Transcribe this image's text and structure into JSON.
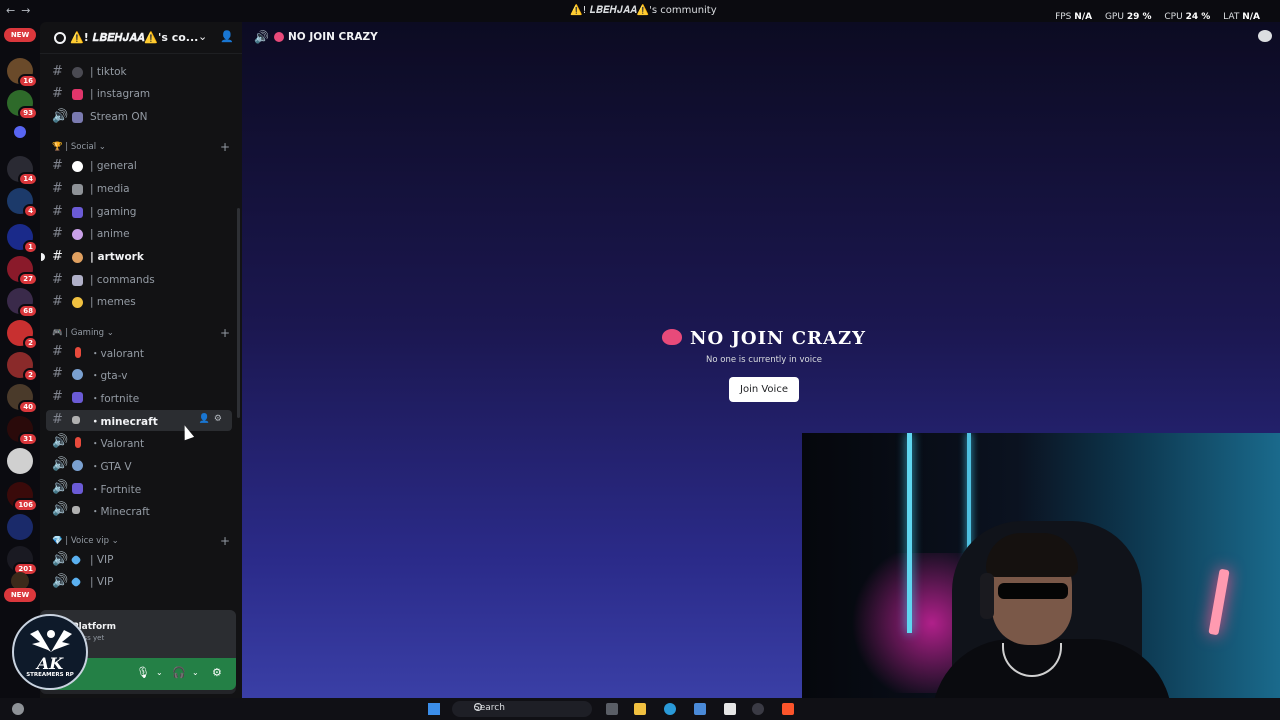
{
  "titlebar": {
    "server_title": "⚠️! 𝑳𝑩𝑬𝑯𝑱𝑨𝑨⚠️'s community",
    "fps_label": "FPS",
    "fps_value": "N/A",
    "gpu_label": "GPU",
    "gpu_value": "29 %",
    "cpu_label": "CPU",
    "cpu_value": "24 %",
    "lat_label": "LAT",
    "lat_value": "N/A"
  },
  "server_rail": {
    "new_top": "NEW",
    "new_bottom": "NEW",
    "badges": [
      "16",
      "93",
      "14",
      "4",
      "1",
      "27",
      "68",
      "2",
      "2",
      "40",
      "31",
      "106",
      "201"
    ]
  },
  "guild": {
    "name": "⚠️! 𝑳𝑩𝑬𝑯𝑱𝑨𝑨⚠️'s co..."
  },
  "channels": {
    "top": [
      {
        "type": "text",
        "label": "| tiktok",
        "color": "#4a4a52"
      },
      {
        "type": "text",
        "label": "| instagram",
        "color": "#e0356a"
      },
      {
        "type": "voice",
        "label": "Stream ON",
        "color": "#7a7ab0"
      }
    ],
    "social": {
      "name": "| Social",
      "items": [
        {
          "type": "text",
          "label": "| general",
          "color": "#ffffff"
        },
        {
          "type": "text",
          "label": "| media",
          "color": "#8e9297"
        },
        {
          "type": "text",
          "label": "| gaming",
          "color": "#6b5bd6"
        },
        {
          "type": "text",
          "label": "| anime",
          "color": "#c9a0e8"
        },
        {
          "type": "text",
          "label": "| artwork",
          "color": "#e0a060",
          "bold": true
        },
        {
          "type": "text",
          "label": "| commands",
          "color": "#b0b0c8"
        },
        {
          "type": "text",
          "label": "| memes",
          "color": "#f0c040"
        }
      ]
    },
    "gaming": {
      "name": "| Gaming",
      "items": [
        {
          "type": "text",
          "label": "・valorant",
          "color": "#e84a3c"
        },
        {
          "type": "text",
          "label": "・gta-v",
          "color": "#7aa0d0"
        },
        {
          "type": "text",
          "label": "・fortnite",
          "color": "#6b5bd6"
        },
        {
          "type": "text",
          "label": "・minecraft",
          "color": "#b0b0b0",
          "active": true
        },
        {
          "type": "voice",
          "label": "・Valorant",
          "color": "#e84a3c"
        },
        {
          "type": "voice",
          "label": "・GTA V",
          "color": "#7aa0d0"
        },
        {
          "type": "voice",
          "label": "・Fortnite",
          "color": "#6b5bd6"
        },
        {
          "type": "voice",
          "label": "・Minecraft",
          "color": "#b0b0b0"
        }
      ]
    },
    "voice_vip": {
      "name": "| Voice vip",
      "items": [
        {
          "type": "voice",
          "label": "| VIP",
          "color": "#5ab0f0"
        },
        {
          "type": "voice",
          "label": "| VIP",
          "color": "#5ab0f0"
        }
      ]
    }
  },
  "user_panel": {
    "activity_name": "Platform",
    "activity_sub": "gress yet",
    "logo_text": "AK",
    "logo_sub": "STREAMERS",
    "logo_sub2": "RP"
  },
  "voice_header": {
    "title": "NO JOIN CRAZY"
  },
  "voice_center": {
    "title": "NO JOIN CRAZY",
    "subtitle": "No one is currently in voice",
    "join_button": "Join Voice"
  },
  "taskbar": {
    "search_placeholder": "Search"
  }
}
